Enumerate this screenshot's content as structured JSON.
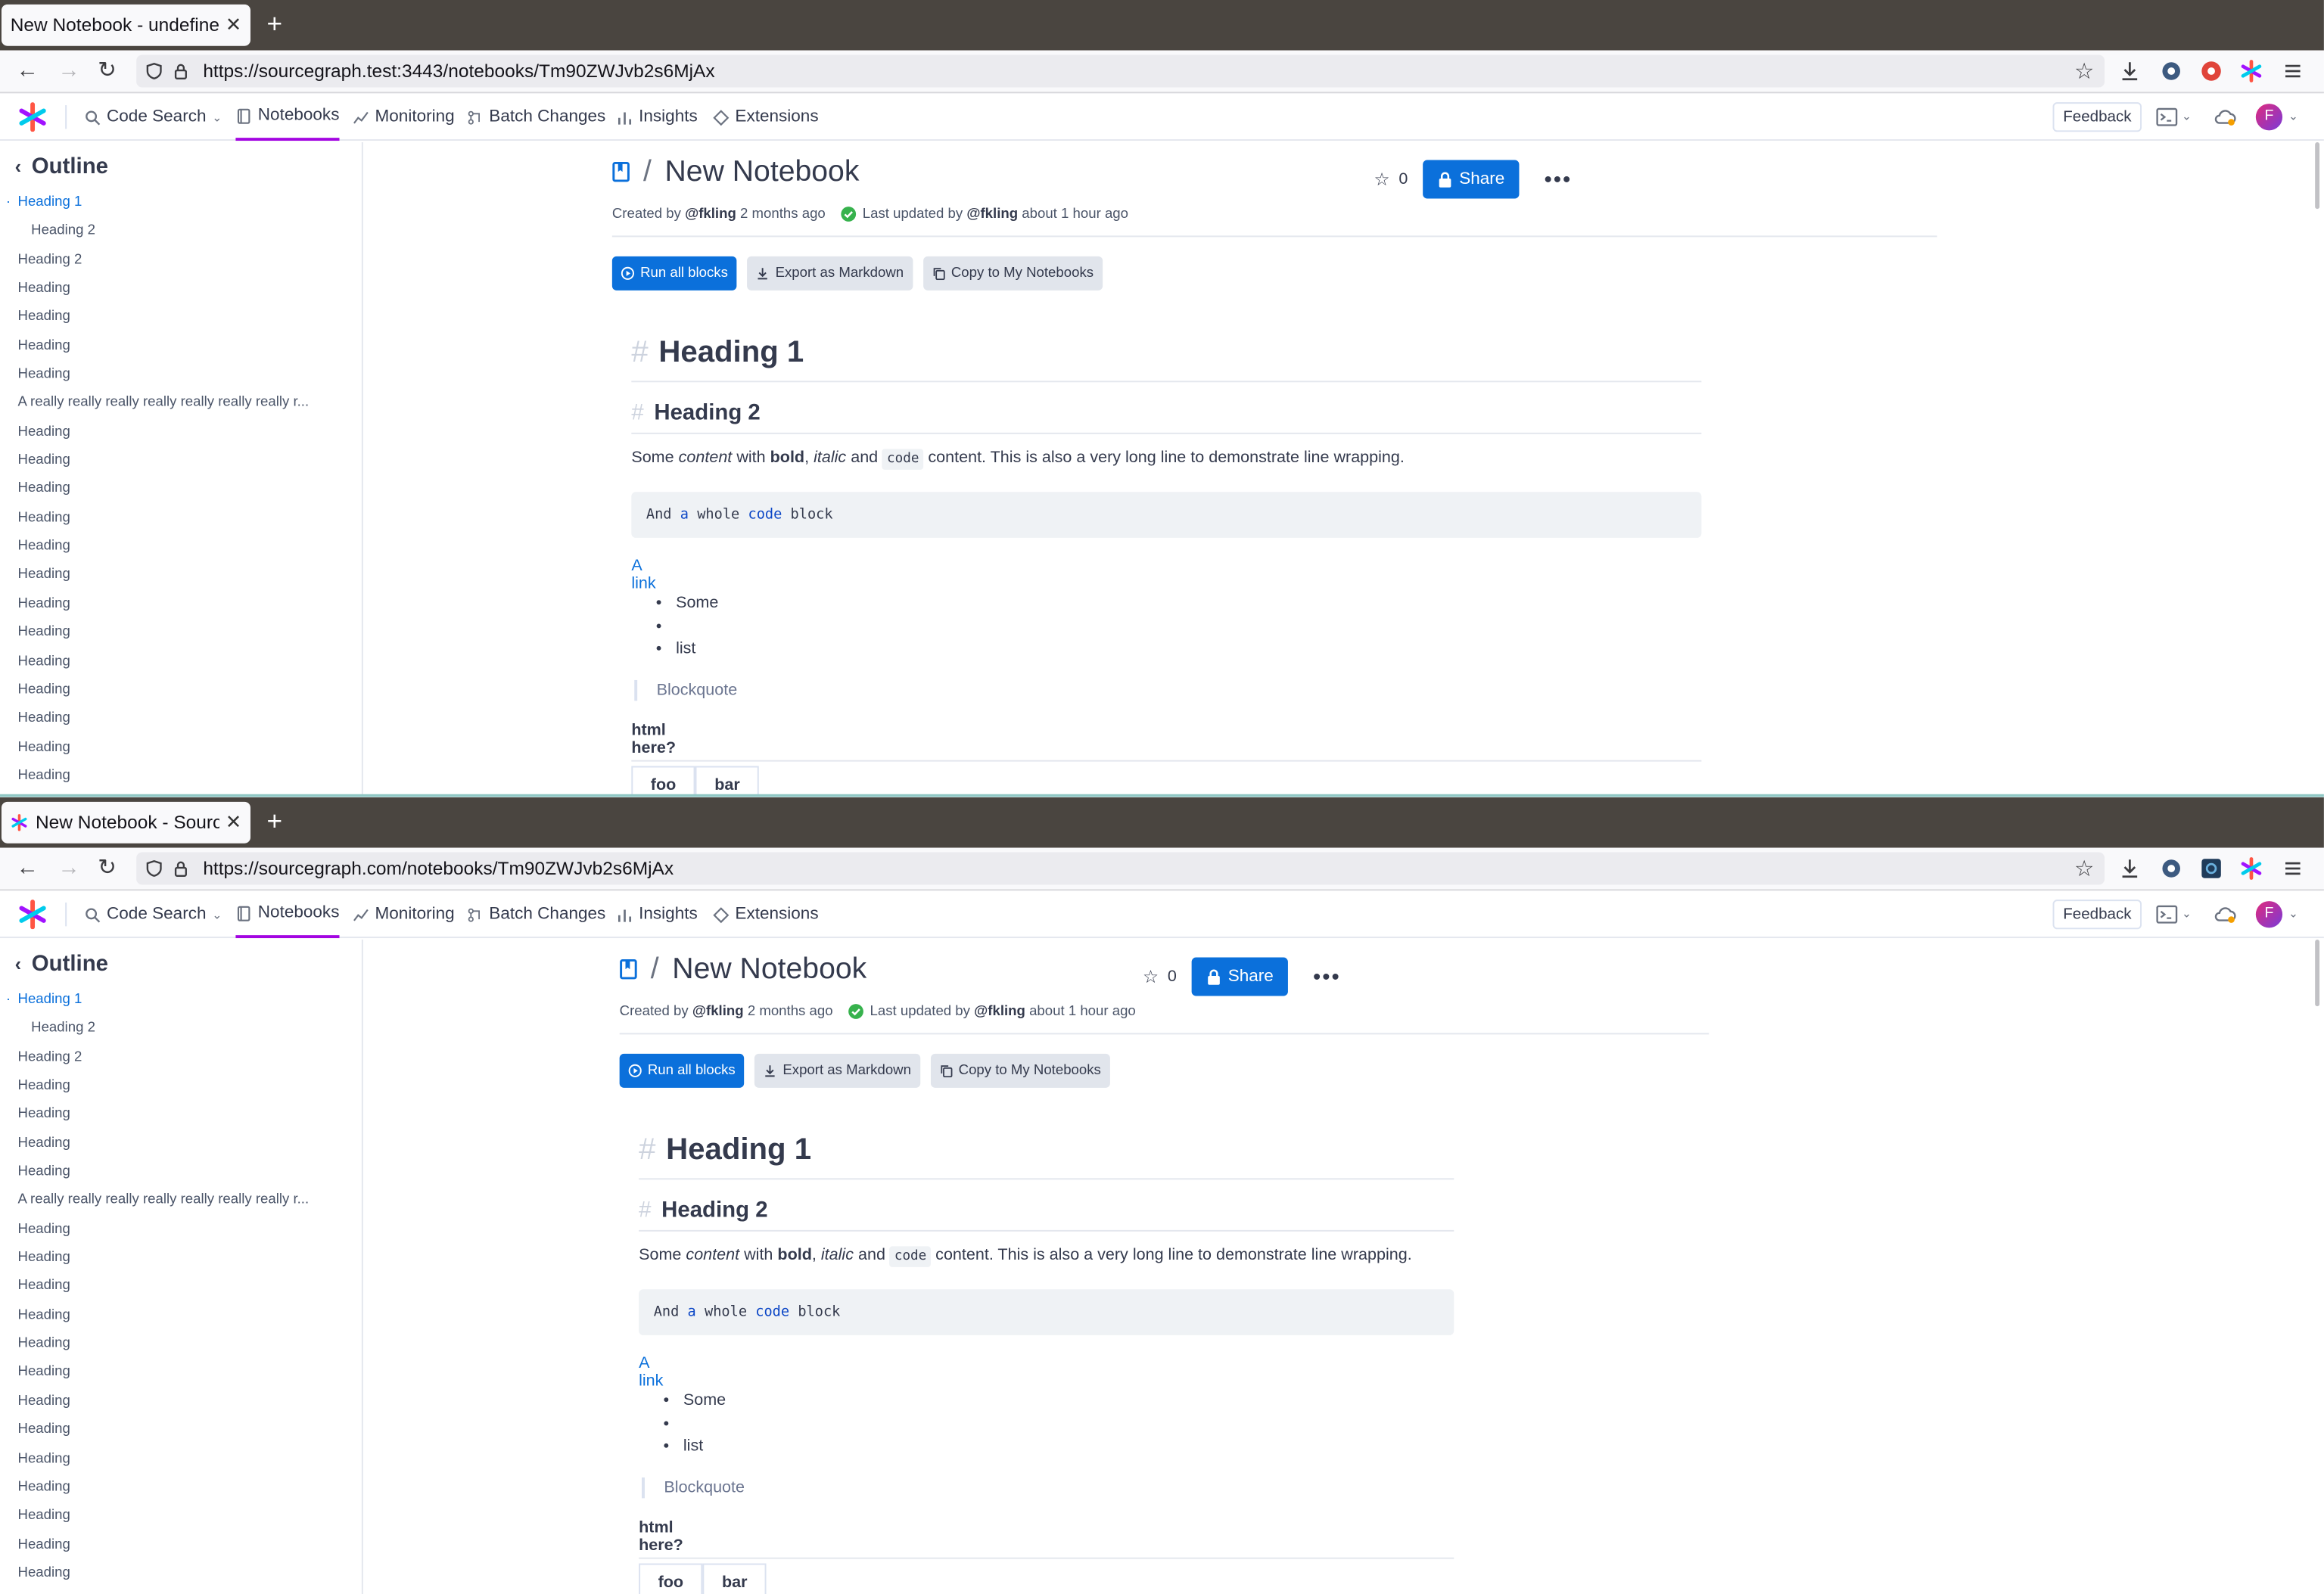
{
  "windows": [
    {
      "tab_title": "New Notebook - undefined",
      "url": "https://sourcegraph.test:3443/notebooks/Tm90ZWJvb2s6MjAx",
      "nav": {
        "code_search": "Code Search",
        "notebooks": "Notebooks",
        "monitoring": "Monitoring",
        "batch_changes": "Batch Changes",
        "insights": "Insights",
        "extensions": "Extensions",
        "feedback": "Feedback",
        "avatar_initial": "F"
      },
      "outline": {
        "title": "Outline",
        "items": [
          "Heading 1",
          "Heading 2",
          "Heading 2",
          "Heading",
          "Heading",
          "Heading",
          "Heading",
          "A really really really really really really really r...",
          "Heading",
          "Heading",
          "Heading",
          "Heading",
          "Heading",
          "Heading",
          "Heading",
          "Heading",
          "Heading",
          "Heading",
          "Heading",
          "Heading",
          "Heading"
        ]
      },
      "notebook": {
        "title": "New Notebook",
        "created_prefix": "Created by",
        "created_by": "@fkling",
        "created_ago": "2 months ago",
        "updated_prefix": "Last updated by",
        "updated_by": "@fkling",
        "updated_ago": "about 1 hour ago",
        "star_count": "0",
        "share": "Share",
        "run_all": "Run all blocks",
        "export_md": "Export as Markdown",
        "copy": "Copy to My Notebooks"
      },
      "content": {
        "h1": "Heading 1",
        "h2": "Heading 2",
        "p_some": "Some",
        "p_content": "content",
        "p_with": "with",
        "p_bold": "bold",
        "p_comma": ",",
        "p_italic": "italic",
        "p_and": "and",
        "p_code": "code",
        "p_rest": "content. This is also a very long line to demonstrate line wrapping.",
        "code_and": "And",
        "code_a": "a",
        "code_whole": "whole",
        "code_code": "code",
        "code_block": "block",
        "link": "A link",
        "list": [
          "Some",
          "",
          "list"
        ],
        "blockquote": "Blockquote",
        "html": "html here?",
        "table_headers": [
          "foo",
          "bar"
        ]
      }
    },
    {
      "tab_title": "New Notebook - Sourcegraph",
      "url": "https://sourcegraph.com/notebooks/Tm90ZWJvb2s6MjAx",
      "nav": {
        "code_search": "Code Search",
        "notebooks": "Notebooks",
        "monitoring": "Monitoring",
        "batch_changes": "Batch Changes",
        "insights": "Insights",
        "extensions": "Extensions",
        "feedback": "Feedback",
        "avatar_initial": "F"
      },
      "outline": {
        "title": "Outline",
        "items": [
          "Heading 1",
          "Heading 2",
          "Heading 2",
          "Heading",
          "Heading",
          "Heading",
          "Heading",
          "A really really really really really really really r...",
          "Heading",
          "Heading",
          "Heading",
          "Heading",
          "Heading",
          "Heading",
          "Heading",
          "Heading",
          "Heading",
          "Heading",
          "Heading",
          "Heading",
          "Heading"
        ]
      },
      "notebook": {
        "title": "New Notebook",
        "created_prefix": "Created by",
        "created_by": "@fkling",
        "created_ago": "2 months ago",
        "updated_prefix": "Last updated by",
        "updated_by": "@fkling",
        "updated_ago": "about 1 hour ago",
        "star_count": "0",
        "share": "Share",
        "run_all": "Run all blocks",
        "export_md": "Export as Markdown",
        "copy": "Copy to My Notebooks"
      },
      "content": {
        "h1": "Heading 1",
        "h2": "Heading 2",
        "p_some": "Some",
        "p_content": "content",
        "p_with": "with",
        "p_bold": "bold",
        "p_comma": ",",
        "p_italic": "italic",
        "p_and": "and",
        "p_code": "code",
        "p_rest": "content. This is also a very long line to demonstrate line wrapping.",
        "code_and": "And",
        "code_a": "a",
        "code_whole": "whole",
        "code_code": "code",
        "code_block": "block",
        "link": "A link",
        "list": [
          "Some",
          "",
          "list"
        ],
        "blockquote": "Blockquote",
        "html": "html here?",
        "table_headers": [
          "foo",
          "bar"
        ]
      }
    }
  ],
  "colors": {
    "accent": "#0b70db",
    "active_nav": "#a305e1",
    "tabstrip": "#4a4540"
  }
}
